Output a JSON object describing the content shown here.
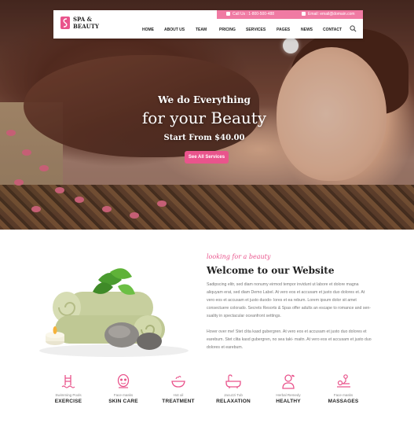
{
  "brand": {
    "name_line1": "SPA &",
    "name_line2": "BEAUTY",
    "accent_color": "#e9548c",
    "topbar_color": "#f07aa3"
  },
  "topbar": {
    "call": "Call Us : 1-800-500-488",
    "email": "Email: email@domain.com"
  },
  "nav": {
    "items": [
      "HOME",
      "ABOUT US",
      "TEAM",
      "PRICING",
      "SERVICES",
      "PAGES",
      "NEWS",
      "CONTACT"
    ],
    "search_icon": "search-icon"
  },
  "hero": {
    "line1": "We do Everything",
    "line2": "for your Beauty",
    "line3": "Start From $40.00",
    "button": "See All Services"
  },
  "welcome": {
    "script": "looking for a beauty",
    "title": "Welcome to our Website",
    "paragraphs": [
      "Sadipscing elitr, sed diam nonumy eirmod tempor invidunt ut labore et dolore magna aliquyam erat, sed diam Demo Label. At vero eos et accusam et justo duo dolores et. At vero eos et accusam et justo duodo- lores et ea rebum. Lorem ipsum dolor sit amet consectuere colorado. Secrets Resorts & Spas offer adults an escape to romance and sen- suality in spectacular oceanfront settings.",
      "Hover over me! Stet clita kasd gubergren. At vero eos et accusam et justo duo dolores et earebum. Stet clita kasd gubergren, no sea taki- maitn. At vero eos et accusam et justo duo dolores et earebum."
    ]
  },
  "services": [
    {
      "icon": "pool-ladder-icon",
      "sub": "Swimming Pools",
      "title": "EXERCISE"
    },
    {
      "icon": "face-mask-icon",
      "sub": "Face masks",
      "title": "SKIN CARE"
    },
    {
      "icon": "bowl-icon",
      "sub": "Hot oil",
      "title": "TREATMENT"
    },
    {
      "icon": "bathtub-icon",
      "sub": "Jacuzzi Tub",
      "title": "RELAXATION"
    },
    {
      "icon": "herbal-person-icon",
      "sub": "Herbal Remedy",
      "title": "HEALTHY"
    },
    {
      "icon": "massage-icon",
      "sub": "Face masks",
      "title": "MASSAGES"
    }
  ]
}
